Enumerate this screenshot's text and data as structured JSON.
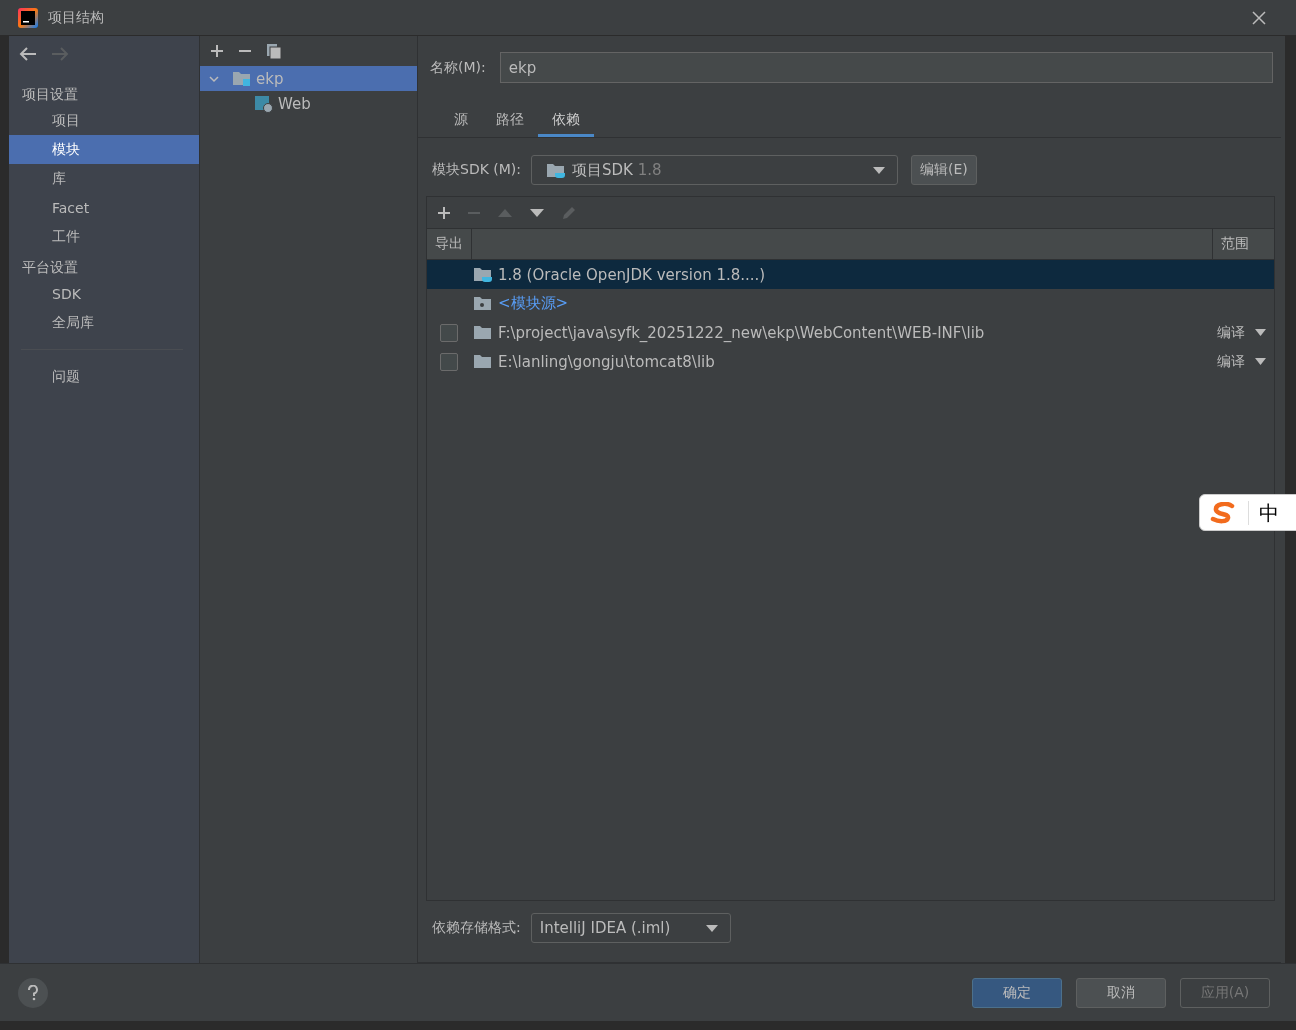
{
  "window": {
    "title": "项目结构"
  },
  "sidebar": {
    "sections": [
      {
        "heading": "项目设置",
        "items": [
          {
            "label": "项目",
            "selected": false
          },
          {
            "label": "模块",
            "selected": true
          },
          {
            "label": "库",
            "selected": false
          },
          {
            "label": "Facet",
            "selected": false
          },
          {
            "label": "工件",
            "selected": false
          }
        ]
      },
      {
        "heading": "平台设置",
        "items": [
          {
            "label": "SDK",
            "selected": false
          },
          {
            "label": "全局库",
            "selected": false
          }
        ]
      }
    ],
    "extra_items": [
      {
        "label": "问题",
        "selected": false
      }
    ]
  },
  "tree": {
    "items": [
      {
        "label": "ekp",
        "selected": true,
        "expanded": true,
        "children": [
          {
            "label": "Web",
            "selected": false
          }
        ]
      }
    ]
  },
  "name_field": {
    "label": "名称(M):",
    "value": "ekp"
  },
  "tabs": [
    {
      "label": "源",
      "selected": false
    },
    {
      "label": "路径",
      "selected": false
    },
    {
      "label": "依赖",
      "selected": true
    }
  ],
  "sdk": {
    "label": "模块SDK (M):",
    "value": "项目SDK",
    "version": "1.8",
    "edit_button": "编辑(E)"
  },
  "toolbar": [
    {
      "kind": "add",
      "disabled": false
    },
    {
      "kind": "remove",
      "disabled": true
    },
    {
      "kind": "up",
      "disabled": true
    },
    {
      "kind": "down",
      "disabled": false
    },
    {
      "kind": "edit",
      "disabled": true
    }
  ],
  "table": {
    "columns": [
      "导出",
      "范围"
    ],
    "rows": [
      {
        "kind": "sdk",
        "text": "1.8 (Oracle OpenJDK version 1.8....)",
        "selected": true
      },
      {
        "kind": "source",
        "text": "<模块源>",
        "selected": false
      },
      {
        "kind": "library",
        "text": "F:\\project\\java\\syfk_20251222_new\\ekp\\WebContent\\WEB-INF\\lib",
        "checked": false,
        "scope": "编译",
        "selected": false
      },
      {
        "kind": "library",
        "text": "E:\\lanling\\gongju\\tomcat8\\lib",
        "checked": false,
        "scope": "编译",
        "selected": false
      }
    ]
  },
  "storage_format": {
    "label": "依赖存储格式:",
    "value": "IntelliJ IDEA (.iml)"
  },
  "buttons": [
    {
      "label": "确定",
      "kind": "primary"
    },
    {
      "label": "取消",
      "kind": "normal"
    },
    {
      "label": "应用(A)",
      "kind": "disabled"
    }
  ],
  "ime": {
    "text": "中"
  }
}
